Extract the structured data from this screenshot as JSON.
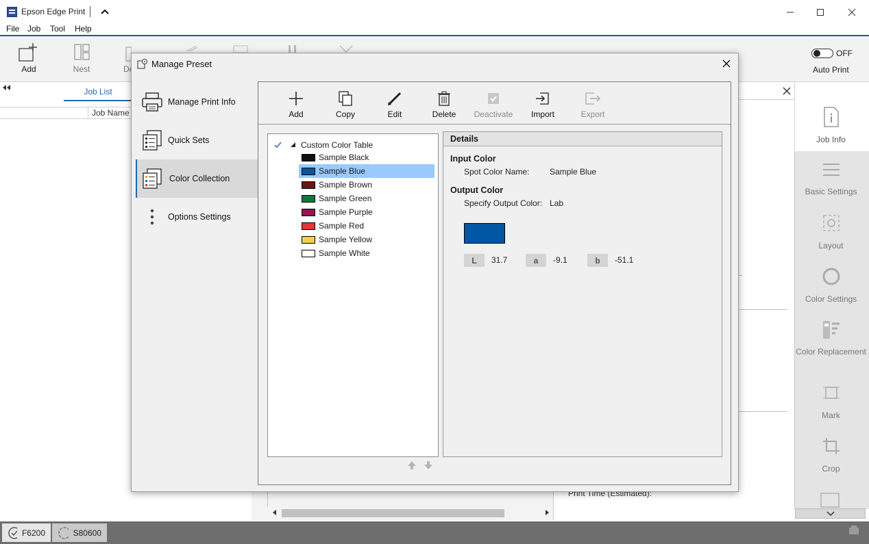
{
  "app": {
    "title": "Epson Edge Print"
  },
  "menu": [
    "File",
    "Job",
    "Tool",
    "Help"
  ],
  "toolbar": {
    "add": "Add",
    "nest": "Nest",
    "del_partial": "De",
    "auto_print_state": "OFF",
    "auto_print_label": "Auto Print"
  },
  "joblist": {
    "tab": "Job List",
    "col_job_name": "Job Name"
  },
  "right_sidebar": {
    "job_info": "Job Info",
    "basic_settings": "Basic Settings",
    "layout": "Layout",
    "color_settings": "Color Settings",
    "color_replacement": "Color Replacement",
    "mark": "Mark",
    "crop": "Crop"
  },
  "background": {
    "print_time": "Print Time (Estimated):"
  },
  "status": {
    "printer1": "F6200",
    "printer2": "S80600"
  },
  "dialog": {
    "title": "Manage Preset",
    "nav": [
      {
        "label": "Manage Print Info"
      },
      {
        "label": "Quick Sets"
      },
      {
        "label": "Color Collection"
      },
      {
        "label": "Options Settings"
      }
    ],
    "actions": {
      "add": "Add",
      "copy": "Copy",
      "edit": "Edit",
      "delete": "Delete",
      "deactivate": "Deactivate",
      "import": "Import",
      "export": "Export"
    },
    "tree": {
      "root": "Custom Color Table",
      "items": [
        {
          "label": "Sample  Black",
          "color": "#111111"
        },
        {
          "label": "Sample  Blue",
          "color": "#0057a3"
        },
        {
          "label": "Sample  Brown",
          "color": "#6b1515"
        },
        {
          "label": "Sample  Green",
          "color": "#0e7a3a"
        },
        {
          "label": "Sample  Purple",
          "color": "#9c0f52"
        },
        {
          "label": "Sample  Red",
          "color": "#e8323c"
        },
        {
          "label": "Sample  Yellow",
          "color": "#f0d24a"
        },
        {
          "label": "Sample White",
          "color": "#ffffff"
        }
      ]
    },
    "details": {
      "header": "Details",
      "input_color_heading": "Input Color",
      "spot_color_name_label": "Spot Color Name:",
      "spot_color_name_value": "Sample  Blue",
      "output_color_heading": "Output Color",
      "specify_output_label": "Specify Output Color:",
      "specify_output_value": "Lab",
      "preview_color": "#0057a3",
      "L_label": "L",
      "L_value": "31.7",
      "a_label": "a",
      "a_value": "-9.1",
      "b_label": "b",
      "b_value": "-51.1"
    }
  }
}
